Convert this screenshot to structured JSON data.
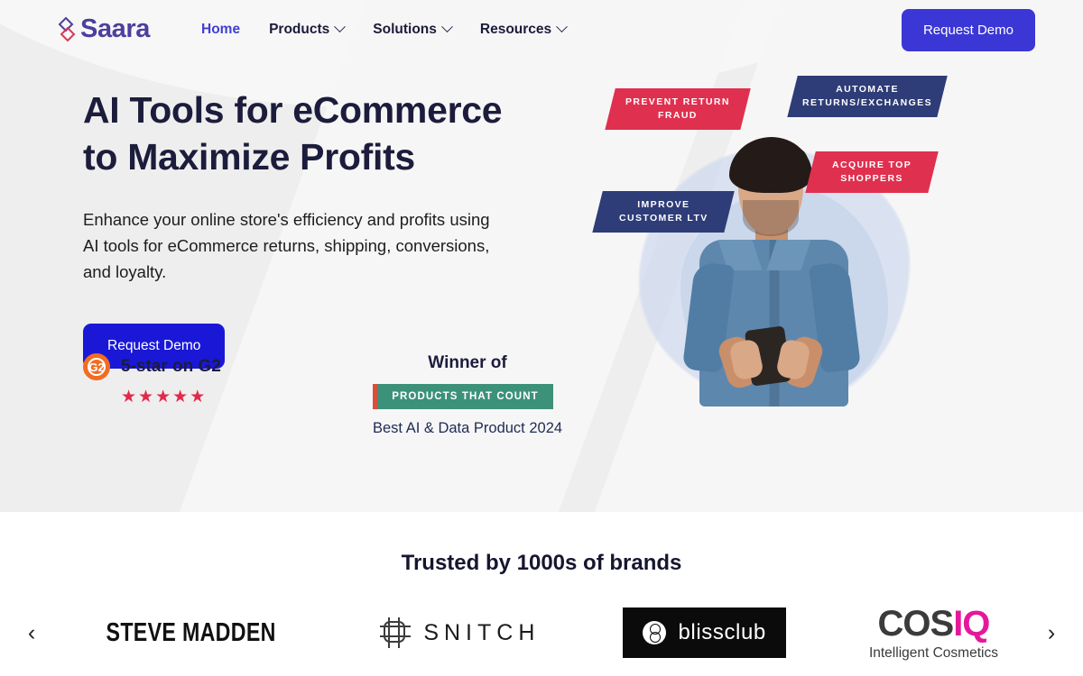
{
  "header": {
    "logo_text": "Saara",
    "logo_icon": "saara-diamond-icon",
    "nav": [
      {
        "label": "Home",
        "icon": null,
        "active": true
      },
      {
        "label": "Products",
        "icon": "chevron-down-icon",
        "active": false
      },
      {
        "label": "Solutions",
        "icon": "chevron-down-icon",
        "active": false
      },
      {
        "label": "Resources",
        "icon": "chevron-down-icon",
        "active": false
      }
    ],
    "cta_label": "Request Demo",
    "cta_color": "#3b37d6"
  },
  "hero": {
    "title_line1": "AI Tools for eCommerce",
    "title_line2": "to Maximize Profits",
    "subtitle": "Enhance your online store's efficiency and profits using AI tools for eCommerce returns, shipping, conversions, and loyalty.",
    "cta_label": "Request Demo",
    "cta_color": "#1a18d6",
    "title_color": "#1c1c3c",
    "background_color": "#efeeee",
    "g2": {
      "badge_text": "G2",
      "badge_color": "#f26d21",
      "label": "5-star on G2",
      "stars": "★★★★★",
      "star_color": "#e12a4a",
      "star_count": 5
    },
    "award": {
      "heading": "Winner of",
      "badge_text": "PRODUCTS THAT COUNT",
      "badge_color": "#3c9179",
      "badge_bar_color": "#d94f3a",
      "subtitle": "Best AI & Data Product 2024"
    },
    "badges": [
      {
        "text": "PREVENT RETURN\nFRAUD",
        "color": "#e0304f",
        "name": "badge-prevent-return-fraud"
      },
      {
        "text": "AUTOMATE\nRETURNS/EXCHANGES",
        "color": "#2e3c77",
        "name": "badge-automate-returns-exchanges"
      },
      {
        "text": "ACQUIRE TOP\nSHOPPERS",
        "color": "#e0304f",
        "name": "badge-acquire-top-shoppers"
      },
      {
        "text": "IMPROVE\nCUSTOMER LTV",
        "color": "#2e3c77",
        "name": "badge-improve-customer-ltv"
      }
    ],
    "image_alt": "man-in-denim-shirt-using-smartphone"
  },
  "brands": {
    "title": "Trusted by 1000s of brands",
    "prev_icon": "chevron-left-icon",
    "next_icon": "chevron-right-icon",
    "prev_glyph": "‹",
    "next_glyph": "›",
    "logos": [
      {
        "name": "steve-madden",
        "text": "STEVE MADDEN"
      },
      {
        "name": "snitch",
        "text": "SNITCH"
      },
      {
        "name": "blissclub",
        "text": "blissclub"
      },
      {
        "name": "cosiq",
        "text_primary": "COS",
        "text_accent": "IQ",
        "tagline": "Intelligent Cosmetics",
        "accent_color": "#e5189c"
      }
    ]
  }
}
